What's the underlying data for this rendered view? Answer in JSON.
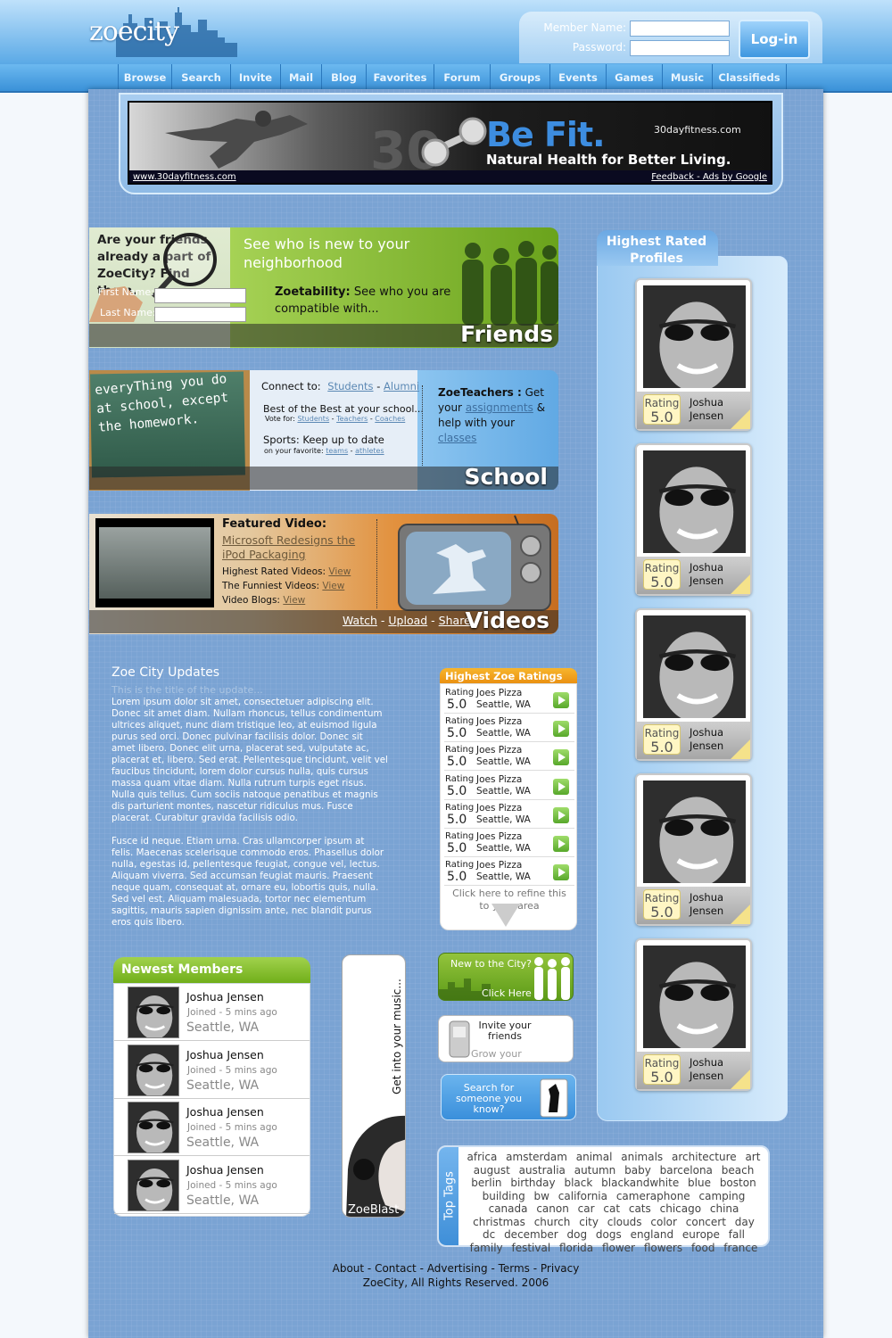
{
  "header": {
    "logo": "zoecity",
    "member_name_label": "Member Name:",
    "password_label": "Password:",
    "member_name_value": "",
    "password_value": "",
    "login_label": "Log-in"
  },
  "nav": [
    "Browse",
    "Search",
    "Invite",
    "Mail",
    "Blog",
    "Favorites",
    "Forum",
    "Groups",
    "Events",
    "Games",
    "Music",
    "Classifieds"
  ],
  "ad": {
    "headline": "Be Fit.",
    "subline": "Natural Health for Better Living.",
    "domain_top": "30dayfitness.com",
    "big_number": "30",
    "url": "www.30dayfitness.com",
    "feedback": "Feedback - Ads by Google"
  },
  "friends": {
    "question": "Are your friends already a part of ZoeCity? Find them.",
    "first_name_label": "First Name:",
    "last_name_label": "Last Name:",
    "first_name_value": "",
    "last_name_value": "",
    "neighborhood": "See who is new to your neighborhood",
    "zoetability_title": "Zoetability:",
    "zoetability_text": "See who you are compatible with...",
    "title": "Friends"
  },
  "school": {
    "chalk": "everyThing you do at school, except the homework.",
    "connect_label": "Connect to:",
    "students": "Students",
    "alumni": "Alumni",
    "best": "Best of the Best at your school...",
    "vote_label": "Vote for:",
    "vote_links": [
      "Students",
      "Teachers",
      "Coaches"
    ],
    "sports": "Sports: Keep up to date",
    "sports_sub": "on your favorite:",
    "sports_links": [
      "teams",
      "athletes"
    ],
    "teachers_title": "ZoeTeachers :",
    "teachers_get": "Get your",
    "assignments": "assignments",
    "help": "& help with your",
    "classes": "classes",
    "title": "School"
  },
  "videos": {
    "featured_label": "Featured Video:",
    "featured_title": "Microsoft Redesigns the iPod Packaging",
    "lines": [
      {
        "label": "Highest Rated Videos:",
        "link": "View"
      },
      {
        "label": "The Funniest Videos:",
        "link": "View"
      },
      {
        "label": "Video Blogs:",
        "link": "View"
      }
    ],
    "watch": "Watch",
    "upload": "Upload",
    "share": "Share",
    "title": "Videos"
  },
  "highest_rated": {
    "title": "Highest Rated Profiles",
    "profiles": [
      {
        "first": "Joshua",
        "last": "Jensen",
        "rating_label": "Rating",
        "rating": "5.0"
      },
      {
        "first": "Joshua",
        "last": "Jensen",
        "rating_label": "Rating",
        "rating": "5.0"
      },
      {
        "first": "Joshua",
        "last": "Jensen",
        "rating_label": "Rating",
        "rating": "5.0"
      },
      {
        "first": "Joshua",
        "last": "Jensen",
        "rating_label": "Rating",
        "rating": "5.0"
      },
      {
        "first": "Joshua",
        "last": "Jensen",
        "rating_label": "Rating",
        "rating": "5.0"
      }
    ]
  },
  "updates": {
    "heading": "Zoe City Updates",
    "subtitle": "This is the title of the update...",
    "p1": "Lorem ipsum dolor sit amet, consectetuer adipiscing elit. Donec sit amet diam. Nullam rhoncus, tellus condimentum ultrices aliquet, nunc diam tristique leo, at euismod ligula purus sed orci. Donec pulvinar facilisis dolor. Donec sit amet libero. Donec elit urna, placerat sed, vulputate ac, placerat et, libero. Sed erat. Pellentesque tincidunt, velit vel faucibus tincidunt, lorem dolor cursus nulla, quis cursus massa quam vitae diam. Nulla rutrum turpis eget risus. Nulla quis tellus. Cum sociis natoque penatibus et magnis dis parturient montes, nascetur ridiculus mus. Fusce placerat. Curabitur gravida facilisis odio.",
    "p2": "Fusce id neque. Etiam urna. Cras ullamcorper ipsum at felis. Maecenas scelerisque commodo eros. Phasellus dolor nulla, egestas id, pellentesque feugiat, congue vel, lectus. Aliquam viverra. Sed accumsan feugiat mauris. Praesent neque quam, consequat at, ornare eu, lobortis quis, nulla. Sed vel est. Aliquam malesuada, tortor nec elementum sagittis, mauris sapien dignissim ante, nec blandit purus eros quis libero."
  },
  "zoe_ratings": {
    "title": "Highest Zoe Ratings",
    "rows": [
      {
        "rating_label": "Rating",
        "rating": "5.0",
        "name": "Joes Pizza",
        "location": "Seattle, WA"
      },
      {
        "rating_label": "Rating",
        "rating": "5.0",
        "name": "Joes Pizza",
        "location": "Seattle, WA"
      },
      {
        "rating_label": "Rating",
        "rating": "5.0",
        "name": "Joes Pizza",
        "location": "Seattle, WA"
      },
      {
        "rating_label": "Rating",
        "rating": "5.0",
        "name": "Joes Pizza",
        "location": "Seattle, WA"
      },
      {
        "rating_label": "Rating",
        "rating": "5.0",
        "name": "Joes Pizza",
        "location": "Seattle, WA"
      },
      {
        "rating_label": "Rating",
        "rating": "5.0",
        "name": "Joes Pizza",
        "location": "Seattle, WA"
      },
      {
        "rating_label": "Rating",
        "rating": "5.0",
        "name": "Joes Pizza",
        "location": "Seattle, WA"
      }
    ],
    "refine": "Click here to refine this to your area"
  },
  "newest_members": {
    "title": "Newest Members",
    "members": [
      {
        "name": "Joshua Jensen",
        "joined": "Joined - 5 mins ago",
        "location": "Seattle, WA"
      },
      {
        "name": "Joshua Jensen",
        "joined": "Joined - 5 mins ago",
        "location": "Seattle, WA"
      },
      {
        "name": "Joshua Jensen",
        "joined": "Joined - 5 mins ago",
        "location": "Seattle, WA"
      },
      {
        "name": "Joshua Jensen",
        "joined": "Joined - 5 mins ago",
        "location": "Seattle, WA"
      }
    ]
  },
  "zoeblast": {
    "tagline": "Get into your music...",
    "name": "ZoeBlast"
  },
  "promos": {
    "new_city": "New to the City?",
    "click_here": "Click Here",
    "invite": "Invite your friends",
    "grow": "Grow your network...",
    "search": "Search for someone you know?"
  },
  "tags": {
    "label": "Top Tags",
    "list": [
      "africa",
      "amsterdam",
      "animal",
      "animals",
      "architecture",
      "art",
      "august",
      "australia",
      "autumn",
      "baby",
      "barcelona",
      "beach",
      "berlin",
      "birthday",
      "black",
      "blackandwhite",
      "blue",
      "boston",
      "building",
      "bw",
      "california",
      "cameraphone",
      "camping",
      "canada",
      "canon",
      "car",
      "cat",
      "cats",
      "chicago",
      "china",
      "christmas",
      "church",
      "city",
      "clouds",
      "color",
      "concert",
      "day",
      "dc",
      "december",
      "dog",
      "dogs",
      "england",
      "europe",
      "fall",
      "family",
      "festival",
      "florida",
      "flower",
      "flowers",
      "food",
      "france"
    ]
  },
  "footer": {
    "links": [
      "About",
      "Contact",
      "Advertising",
      "Terms",
      "Privacy"
    ],
    "copyright": "ZoeCity, All Rights Reserved. 2006"
  },
  "colors": {
    "header_blue": "#5aa9e6",
    "page_blue": "#7aa3d3",
    "friends_green": "#8fc43a",
    "school_blue": "#7db8e9",
    "videos_orange": "#e2913e",
    "members_green": "#7fb723",
    "ratings_orange": "#f0a020"
  }
}
